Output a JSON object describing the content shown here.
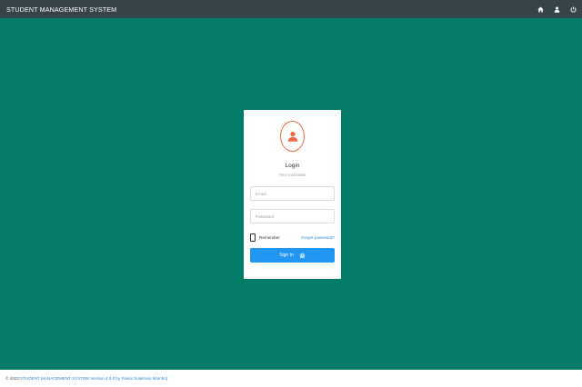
{
  "app": {
    "title": "STUDENT MANAGEMENT SYSTEM"
  },
  "topbar": {
    "icons": [
      "home-icon",
      "user-icon",
      "power-icon"
    ]
  },
  "login": {
    "title": "Login",
    "subtitle": "Your credentials",
    "email_placeholder": "Email",
    "password_placeholder": "Password",
    "remember_label": "Remember",
    "forgot_label": "Forgot password?",
    "signin_label": "Sign In",
    "remember_checked": false
  },
  "footer": {
    "copyright": "© 2022",
    "separator": ": ",
    "link_text": "STUDENT MANAGEMENT SYSTEM Version 4.0.0 by Faisal Suleiman Mombo]"
  },
  "colors": {
    "background": "#027c69",
    "topbar": "#36444a",
    "avatar_accent": "#ef6a3c",
    "primary_button": "#2196f3",
    "link": "#2a8bd6"
  }
}
